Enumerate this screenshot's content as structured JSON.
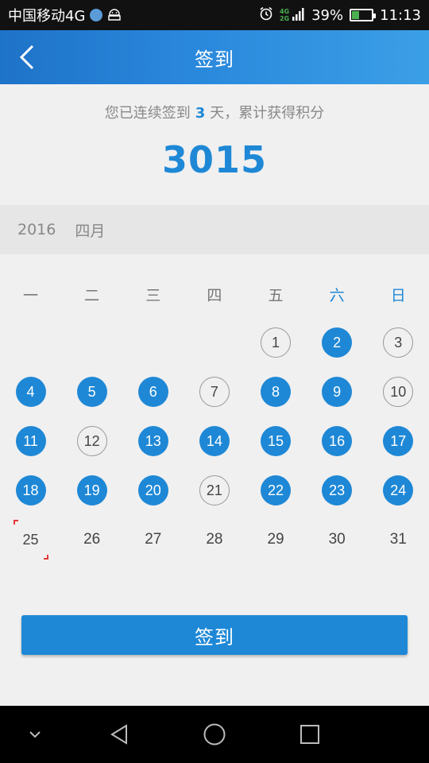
{
  "status_bar": {
    "carrier": "中国移动4G",
    "network_top": "4G",
    "network_bottom": "2G",
    "battery": "39%",
    "battery_level": 0.39,
    "time": "11:13"
  },
  "header": {
    "title": "签到"
  },
  "summary": {
    "prefix": "您已连续签到",
    "days": "3",
    "suffix": "天，累计获得积分",
    "points": "3015"
  },
  "month": {
    "year": "2016",
    "month": "四月"
  },
  "calendar": {
    "weekdays": [
      "一",
      "二",
      "三",
      "四",
      "五",
      "六",
      "日"
    ],
    "weekend_indexes": [
      5,
      6
    ],
    "leading_blanks": 4,
    "days": [
      {
        "d": "1",
        "s": "unsigned"
      },
      {
        "d": "2",
        "s": "signed"
      },
      {
        "d": "3",
        "s": "unsigned"
      },
      {
        "d": "4",
        "s": "signed"
      },
      {
        "d": "5",
        "s": "signed"
      },
      {
        "d": "6",
        "s": "signed"
      },
      {
        "d": "7",
        "s": "unsigned"
      },
      {
        "d": "8",
        "s": "signed"
      },
      {
        "d": "9",
        "s": "signed"
      },
      {
        "d": "10",
        "s": "unsigned"
      },
      {
        "d": "11",
        "s": "signed"
      },
      {
        "d": "12",
        "s": "unsigned"
      },
      {
        "d": "13",
        "s": "signed"
      },
      {
        "d": "14",
        "s": "signed"
      },
      {
        "d": "15",
        "s": "signed"
      },
      {
        "d": "16",
        "s": "signed"
      },
      {
        "d": "17",
        "s": "signed"
      },
      {
        "d": "18",
        "s": "signed"
      },
      {
        "d": "19",
        "s": "signed"
      },
      {
        "d": "20",
        "s": "signed"
      },
      {
        "d": "21",
        "s": "unsigned"
      },
      {
        "d": "22",
        "s": "signed"
      },
      {
        "d": "23",
        "s": "signed"
      },
      {
        "d": "24",
        "s": "signed"
      },
      {
        "d": "25",
        "s": "today"
      },
      {
        "d": "26",
        "s": "future"
      },
      {
        "d": "27",
        "s": "future"
      },
      {
        "d": "28",
        "s": "future"
      },
      {
        "d": "29",
        "s": "future"
      },
      {
        "d": "30",
        "s": "future"
      },
      {
        "d": "31",
        "s": "future"
      }
    ]
  },
  "sign_button": {
    "label": "签到"
  },
  "colors": {
    "accent": "#1e88d6",
    "today_marker": "#e53935"
  }
}
